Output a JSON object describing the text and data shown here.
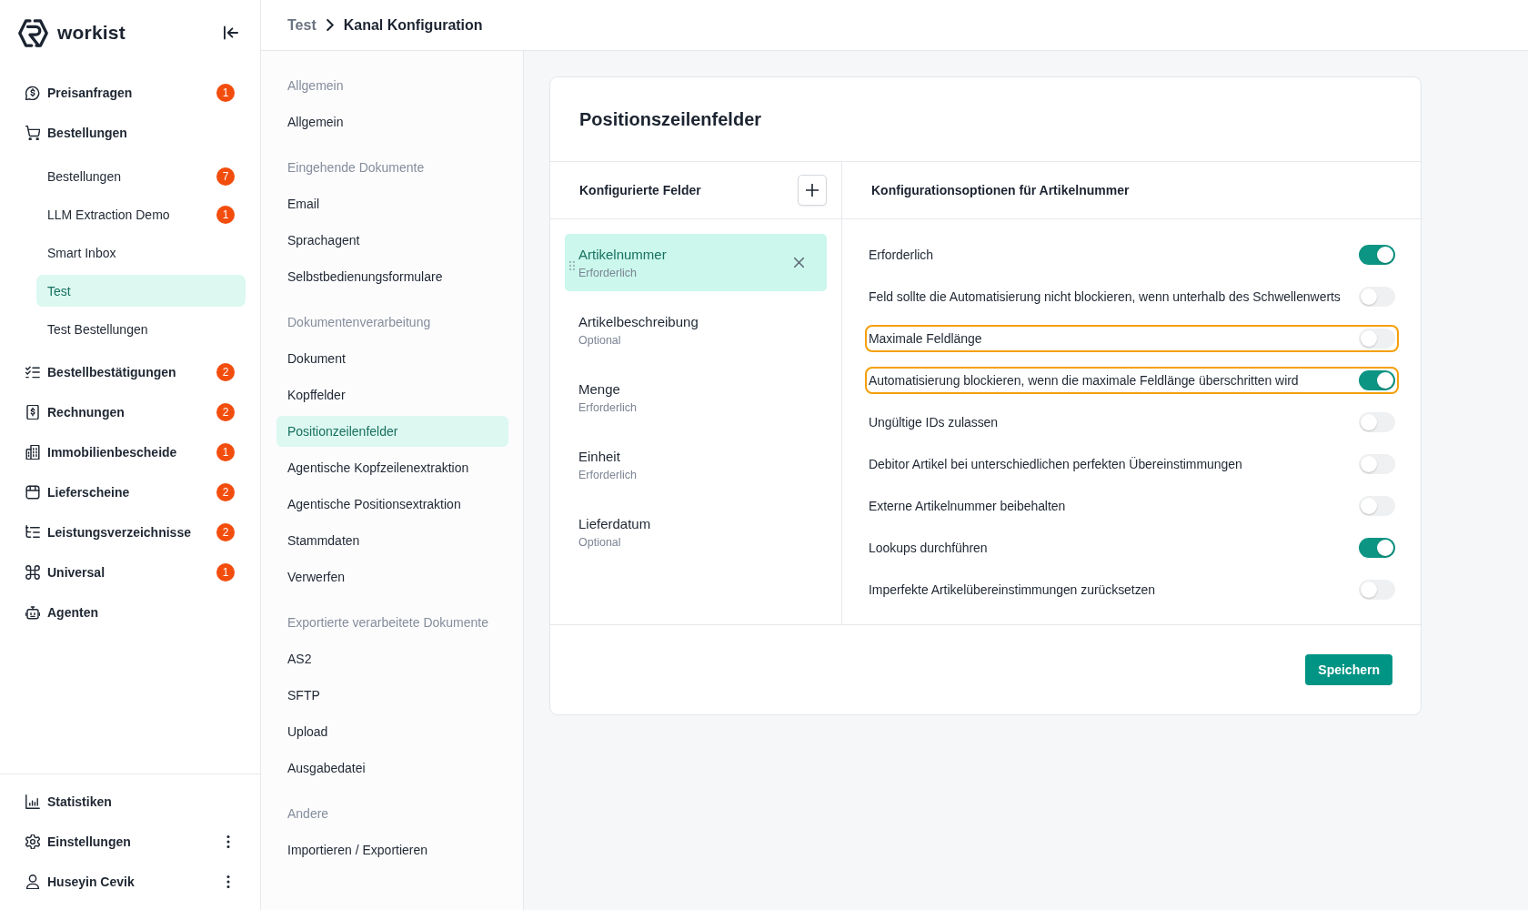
{
  "sidebar": {
    "logo": "workist",
    "nav": [
      {
        "label": "Preisanfragen",
        "badge": "1",
        "selected": false
      },
      {
        "label": "Bestellungen",
        "selected": false,
        "children": [
          {
            "label": "Bestellungen",
            "badge": "7",
            "selected": false
          },
          {
            "label": "LLM Extraction Demo",
            "badge": "1",
            "selected": false
          },
          {
            "label": "Smart Inbox",
            "selected": false
          },
          {
            "label": "Test",
            "selected": true
          },
          {
            "label": "Test Bestellungen",
            "selected": false
          }
        ]
      },
      {
        "label": "Bestellbestätigungen",
        "badge": "2",
        "selected": false
      },
      {
        "label": "Rechnungen",
        "badge": "2",
        "selected": false
      },
      {
        "label": "Immobilienbescheide",
        "badge": "1",
        "selected": false
      },
      {
        "label": "Lieferscheine",
        "badge": "2",
        "selected": false
      },
      {
        "label": "Leistungsverzeichnisse",
        "badge": "2",
        "selected": false
      },
      {
        "label": "Universal",
        "badge": "1",
        "selected": false
      },
      {
        "label": "Agenten",
        "selected": false
      }
    ],
    "footer_nav": [
      {
        "label": "Statistiken",
        "kind": "link",
        "selected": false
      },
      {
        "label": "Einstellungen",
        "kind": "menu",
        "selected": false
      },
      {
        "label": "Huseyin Cevik",
        "kind": "menu",
        "selected": false
      }
    ]
  },
  "breadcrumb": [
    {
      "label": "Test"
    },
    {
      "label": "Kanal Konfiguration"
    }
  ],
  "settings_nav": [
    {
      "title": "Allgemein",
      "items": [
        {
          "label": "Allgemein",
          "selected": false
        }
      ]
    },
    {
      "title": "Eingehende Dokumente",
      "items": [
        {
          "label": "Email",
          "selected": false
        },
        {
          "label": "Sprachagent",
          "selected": false
        },
        {
          "label": "Selbstbedienungsformulare",
          "selected": false
        }
      ]
    },
    {
      "title": "Dokumentenverarbeitung",
      "items": [
        {
          "label": "Dokument",
          "selected": false
        },
        {
          "label": "Kopffelder",
          "selected": false
        },
        {
          "label": "Positionzeilenfelder",
          "selected": true
        },
        {
          "label": "Agentische Kopfzeilenextraktion",
          "selected": false
        },
        {
          "label": "Agentische Positionsextraktion",
          "selected": false
        },
        {
          "label": "Stammdaten",
          "selected": false
        },
        {
          "label": "Verwerfen",
          "selected": false
        }
      ]
    },
    {
      "title": "Exportierte verarbeitete Dokumente",
      "items": [
        {
          "label": "AS2",
          "selected": false
        },
        {
          "label": "SFTP",
          "selected": false
        },
        {
          "label": "Upload",
          "selected": false
        },
        {
          "label": "Ausgabedatei",
          "selected": false
        }
      ]
    },
    {
      "title": "Andere",
      "items": [
        {
          "label": "Importieren / Exportieren",
          "selected": false
        }
      ]
    }
  ],
  "card": {
    "title": "Positionszeilenfelder",
    "fields_panel": {
      "title": "Konfigurierte Felder",
      "fields": [
        {
          "name": "Artikelnummer",
          "requirement": "Erforderlich",
          "selected": true
        },
        {
          "name": "Artikelbeschreibung",
          "requirement": "Optional",
          "selected": false
        },
        {
          "name": "Menge",
          "requirement": "Erforderlich",
          "selected": false
        },
        {
          "name": "Einheit",
          "requirement": "Erforderlich",
          "selected": false
        },
        {
          "name": "Lieferdatum",
          "requirement": "Optional",
          "selected": false
        }
      ]
    },
    "options_panel": {
      "title": "Konfigurationsoptionen für Artikelnummer",
      "options": [
        {
          "label": "Erforderlich",
          "on": true,
          "highlighted": false
        },
        {
          "label": "Feld sollte die Automatisierung nicht blockieren, wenn unterhalb des Schwellenwerts",
          "on": false,
          "highlighted": false
        },
        {
          "label": "Maximale Feldlänge",
          "on": false,
          "highlighted": true
        },
        {
          "label": "Automatisierung blockieren, wenn die maximale Feldlänge überschritten wird",
          "on": true,
          "highlighted": true
        },
        {
          "label": "Ungültige IDs zulassen",
          "on": false,
          "highlighted": false
        },
        {
          "label": "Debitor Artikel bei unterschiedlichen perfekten Übereinstimmungen",
          "on": false,
          "highlighted": false
        },
        {
          "label": "Externe Artikelnummer beibehalten",
          "on": false,
          "highlighted": false
        },
        {
          "label": "Lookups durchführen",
          "on": true,
          "highlighted": false
        },
        {
          "label": "Imperfekte Artikelübereinstimmungen zurücksetzen",
          "on": false,
          "highlighted": false
        }
      ]
    },
    "save_button": "Speichern"
  }
}
